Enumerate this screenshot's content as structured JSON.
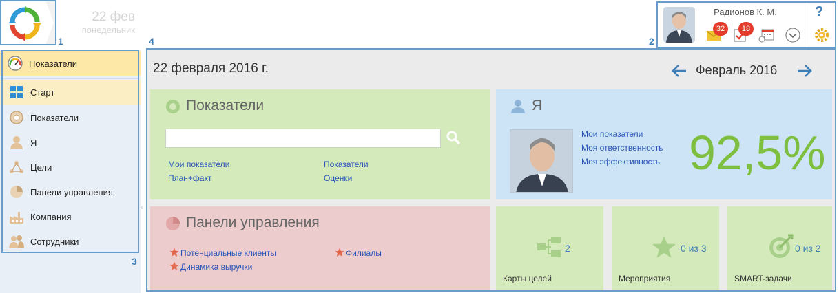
{
  "header": {
    "date_day": "22 фев",
    "date_weekday": "понедельник"
  },
  "user": {
    "name": "Радионов К. М.",
    "messages_count": "32",
    "tasks_count": "18",
    "help_label": "?"
  },
  "callouts": [
    "1",
    "2",
    "3",
    "4"
  ],
  "sidebar": {
    "header_label": "Показатели",
    "items": [
      {
        "label": "Старт",
        "icon": "tiles-icon"
      },
      {
        "label": "Показатели",
        "icon": "gauge-icon"
      },
      {
        "label": "Я",
        "icon": "user-icon"
      },
      {
        "label": "Цели",
        "icon": "goals-icon"
      },
      {
        "label": "Панели управления",
        "icon": "pie-icon"
      },
      {
        "label": "Компания",
        "icon": "factory-icon"
      },
      {
        "label": "Сотрудники",
        "icon": "people-icon"
      }
    ]
  },
  "main": {
    "date": "22 февраля 2016 г.",
    "month": "Февраль 2016"
  },
  "pokazateli_tile": {
    "title": "Показатели",
    "search_value": "",
    "links": [
      "Мои показатели",
      "План+факт",
      "Показатели",
      "Оценки"
    ]
  },
  "me_tile": {
    "title": "Я",
    "links": [
      "Мои показатели",
      "Моя ответственность",
      "Моя эффективность"
    ],
    "percent": "92,5%"
  },
  "panels_tile": {
    "title": "Панели управления",
    "links": [
      "Потенциальные клиенты",
      "Динамика выручки",
      "Филиалы"
    ]
  },
  "small_tiles": [
    {
      "label": "Карты целей",
      "count": "2",
      "icon": "goal-map-icon"
    },
    {
      "label": "Мероприятия",
      "count": "0 из 3",
      "icon": "star-icon"
    },
    {
      "label": "SMART-задачи",
      "count": "0 из 2",
      "icon": "target-icon"
    }
  ],
  "colors": {
    "accent": "#3f7fb8",
    "green_tile": "#d4eabb",
    "blue_tile": "#cce4f6",
    "red_tile": "#eccccc",
    "badge": "#e43b2c",
    "percent": "#7fbf3f"
  }
}
